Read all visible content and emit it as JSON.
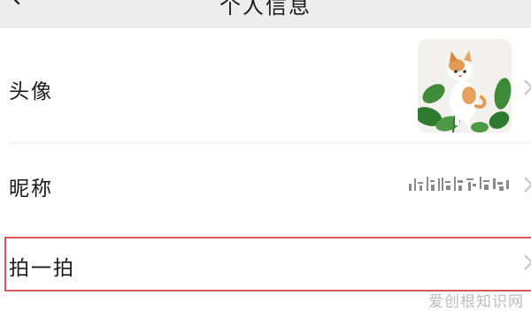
{
  "navbar": {
    "title": "个人信息"
  },
  "rows": [
    {
      "label": "头像",
      "value_type": "avatar-image"
    },
    {
      "label": "昵称",
      "value": ""
    },
    {
      "label": "拍一拍",
      "highlighted": true,
      "highlight_color": "#e0545a"
    }
  ],
  "watermark": "爱创根知识网",
  "colors": {
    "navbar_bg": "#ededed",
    "divider": "#ececec",
    "chevron": "#c4c4c4"
  }
}
